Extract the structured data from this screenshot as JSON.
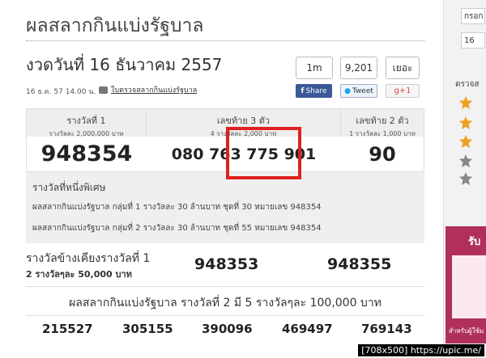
{
  "page": {
    "title": "ผลสลากกินแบ่งรัฐบาล",
    "draw_title": "งวดวันที่ 16 ธันวาคม 2557",
    "meta_date": "16 ธ.ค. 57 14.00 น.",
    "print_link": "ใบตรวจสลากกินแบ่งรัฐบาล"
  },
  "social": {
    "fb_count": "1m",
    "tw_count": "9,201",
    "more_label": "เยอะ",
    "fb_share": "Share",
    "tw_tweet": "Tweet",
    "gplus": "g+1"
  },
  "prizes": {
    "first": {
      "title": "รางวัลที่ 1",
      "sub": "รางวัลละ 2,000,000 บาท",
      "number": "948354"
    },
    "last3": {
      "title": "เลขท้าย 3 ตัว",
      "sub": "4 รางวัลละ 2,000 บาท",
      "number": "080 763 775 901"
    },
    "last2": {
      "title": "เลขท้าย 2 ตัว",
      "sub": "1 รางวัลละ 1,000 บาท",
      "number": "90"
    }
  },
  "special": {
    "heading": "รางวัลที่หนึ่งพิเศษ",
    "line1": "ผลสลากกินแบ่งรัฐบาล กลุ่มที่ 1 รางวัลละ 30 ล้านบาท ชุดที่ 30 หมายเลข 948354",
    "line2": "ผลสลากกินแบ่งรัฐบาล กลุ่มที่ 2 รางวัลละ 30 ล้านบาท ชุดที่ 55 หมายเลข 948354"
  },
  "near": {
    "label1": "รางวัลข้างเคียงรางวัลที่ 1",
    "label2": "2 รางวัลๆละ 50,000 บาท",
    "numbers": [
      "948353",
      "948355"
    ]
  },
  "second": {
    "title": "ผลสลากกินแบ่งรัฐบาล รางวัลที่ 2 มี 5 รางวัลๆละ 100,000 บาท",
    "numbers": [
      "215527",
      "305155",
      "390096",
      "469497",
      "769143"
    ]
  },
  "sidebar": {
    "input1": "กรอก",
    "input2": "16",
    "heading": "ตรวจส",
    "banner_title": "รับ",
    "banner_caption": "สำหรับผู้ใช้ม"
  },
  "watermark": "[708x500] https://upic.me/",
  "colors": {
    "highlight": "#e02020",
    "facebook": "#3b5998",
    "banner": "#b0305a"
  }
}
